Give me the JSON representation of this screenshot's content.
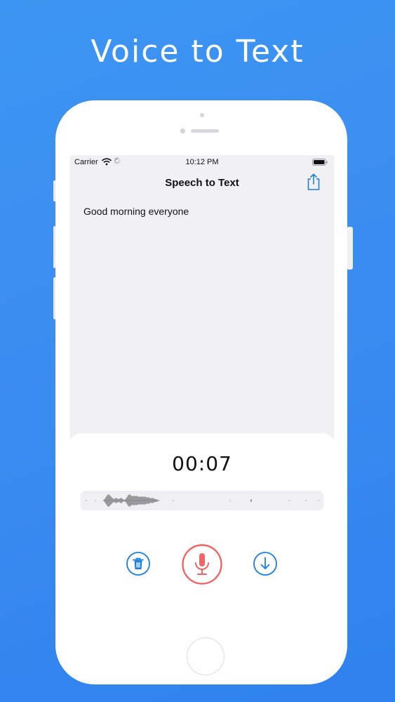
{
  "promo": {
    "title": "Voice to Text"
  },
  "status_bar": {
    "carrier": "Carrier",
    "time": "10:12 PM"
  },
  "nav": {
    "title": "Speech to Text",
    "share_icon": "share-icon"
  },
  "transcript": {
    "text": "Good morning everyone"
  },
  "recorder": {
    "timer": "00:07",
    "buttons": {
      "delete_icon": "trash-icon",
      "record_icon": "microphone-icon",
      "save_icon": "download-icon"
    }
  },
  "colors": {
    "background": "#3a8cf0",
    "accent_blue": "#1a7fe3",
    "record_red": "#f06466",
    "screen_bg": "#f1f1f4"
  }
}
